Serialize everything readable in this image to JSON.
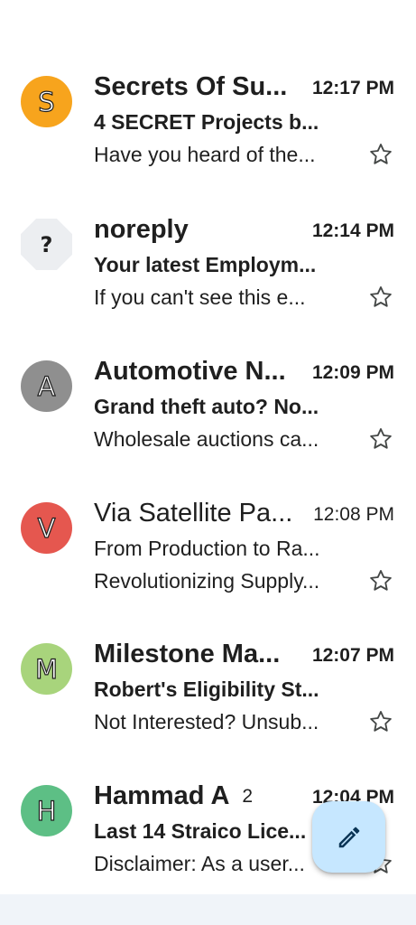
{
  "emails": [
    {
      "avatar_letter": "S",
      "avatar_color": "#f7a41d",
      "sender": "Secrets Of Su...",
      "count": "",
      "time": "12:17 PM",
      "subject": "4 SECRET Projects b...",
      "snippet": "Have you heard of the...",
      "unread": true,
      "starred": false
    },
    {
      "avatar_letter": "?",
      "avatar_color": "#eceef1",
      "sender": "noreply",
      "count": "",
      "time": "12:14 PM",
      "subject": "Your latest Employm...",
      "snippet": "If you can't see this e...",
      "unread": true,
      "starred": false
    },
    {
      "avatar_letter": "A",
      "avatar_color": "#8f8f8f",
      "sender": "Automotive N...",
      "count": "",
      "time": "12:09 PM",
      "subject": "Grand theft auto? No...",
      "snippet": "Wholesale auctions ca...",
      "unread": true,
      "starred": false
    },
    {
      "avatar_letter": "V",
      "avatar_color": "#e5574f",
      "sender": "Via Satellite Pa...",
      "count": "",
      "time": "12:08 PM",
      "subject": "From Production to Ra...",
      "snippet": "Revolutionizing Supply...",
      "unread": false,
      "starred": false
    },
    {
      "avatar_letter": "M",
      "avatar_color": "#a8d47c",
      "sender": "Milestone Ma...",
      "count": "",
      "time": "12:07 PM",
      "subject": "Robert's Eligibility St...",
      "snippet": "Not Interested? Unsub...",
      "unread": true,
      "starred": false
    },
    {
      "avatar_letter": "H",
      "avatar_color": "#5dbf85",
      "sender": "Hammad A",
      "count": "2",
      "time": "12:04 PM",
      "subject": "Last 14 Straico Lice...",
      "snippet": "Disclaimer: As a user...",
      "unread": true,
      "starred": false
    }
  ],
  "compose": {
    "icon": "pencil-icon",
    "color": "#c6e7ff"
  },
  "colors": {
    "background": "#ffffff",
    "bottom_bar": "#f0f4f9",
    "text": "#1f1f1f"
  }
}
